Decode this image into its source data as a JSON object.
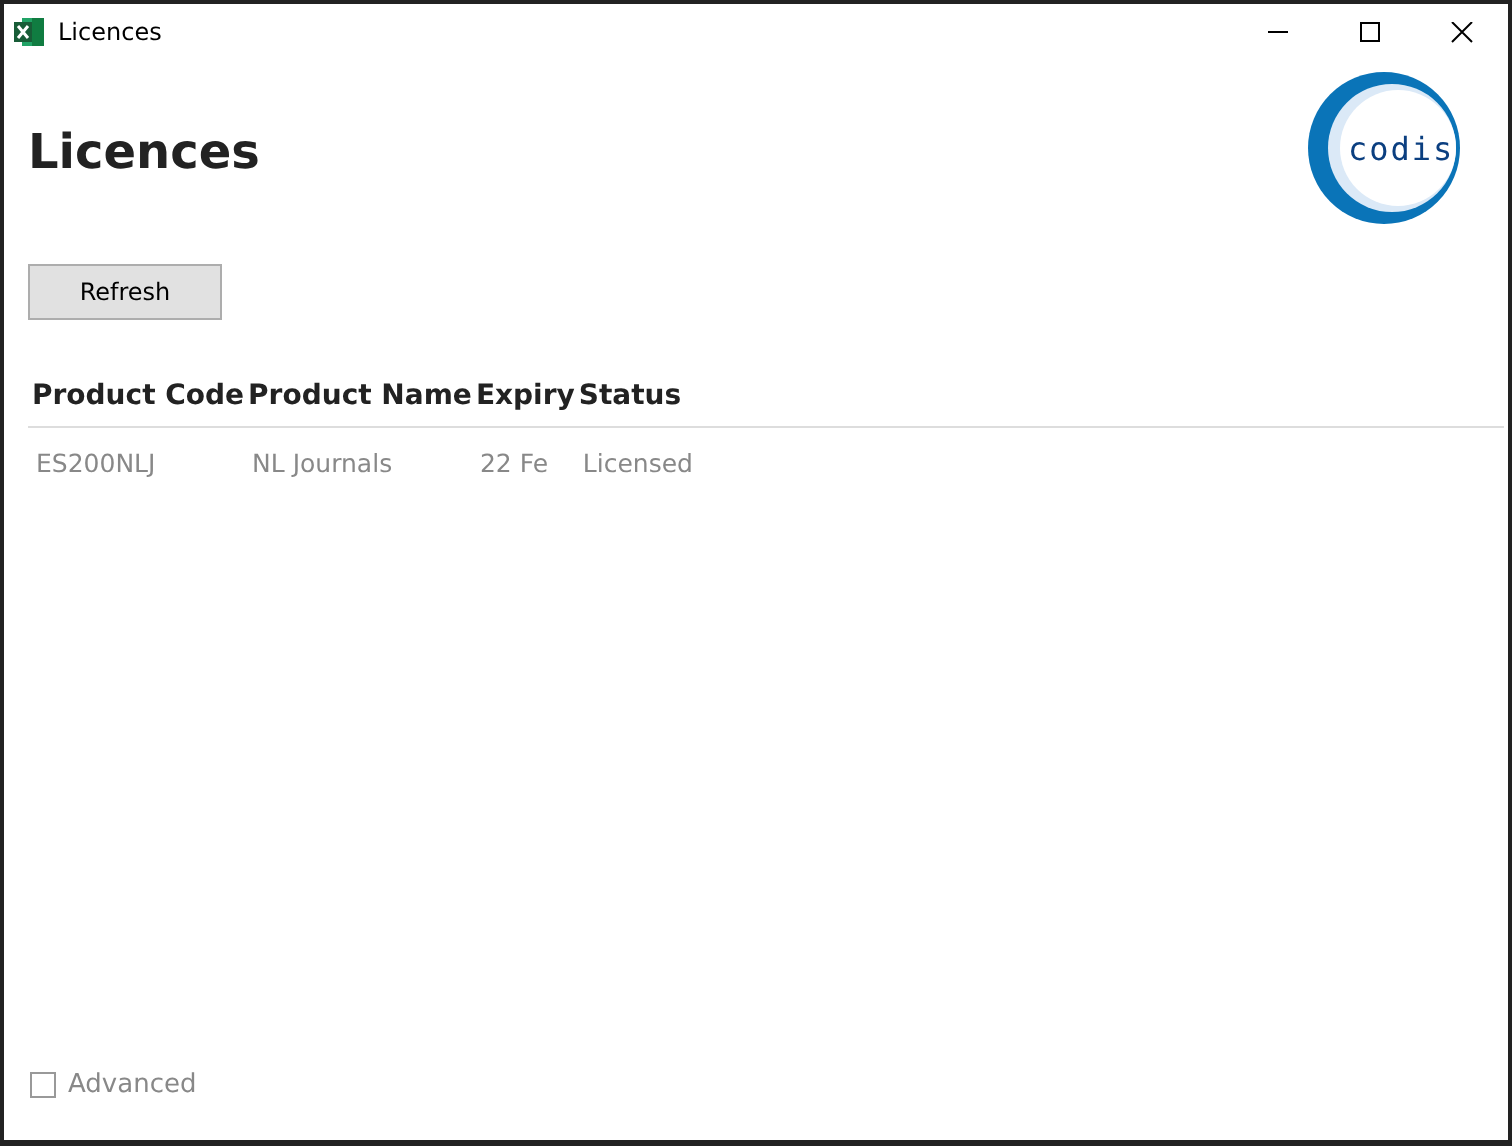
{
  "window": {
    "title": "Licences"
  },
  "heading": "Licences",
  "logo": {
    "text": "codis"
  },
  "refresh_button": "Refresh",
  "table": {
    "columns": [
      "Product Code",
      "Product Name",
      "Expiry",
      "Status"
    ],
    "rows": [
      [
        "ES200NLJ",
        "NL Journals",
        "22 Fe",
        "Licensed"
      ]
    ]
  },
  "advanced": {
    "label": "Advanced",
    "checked": false
  }
}
